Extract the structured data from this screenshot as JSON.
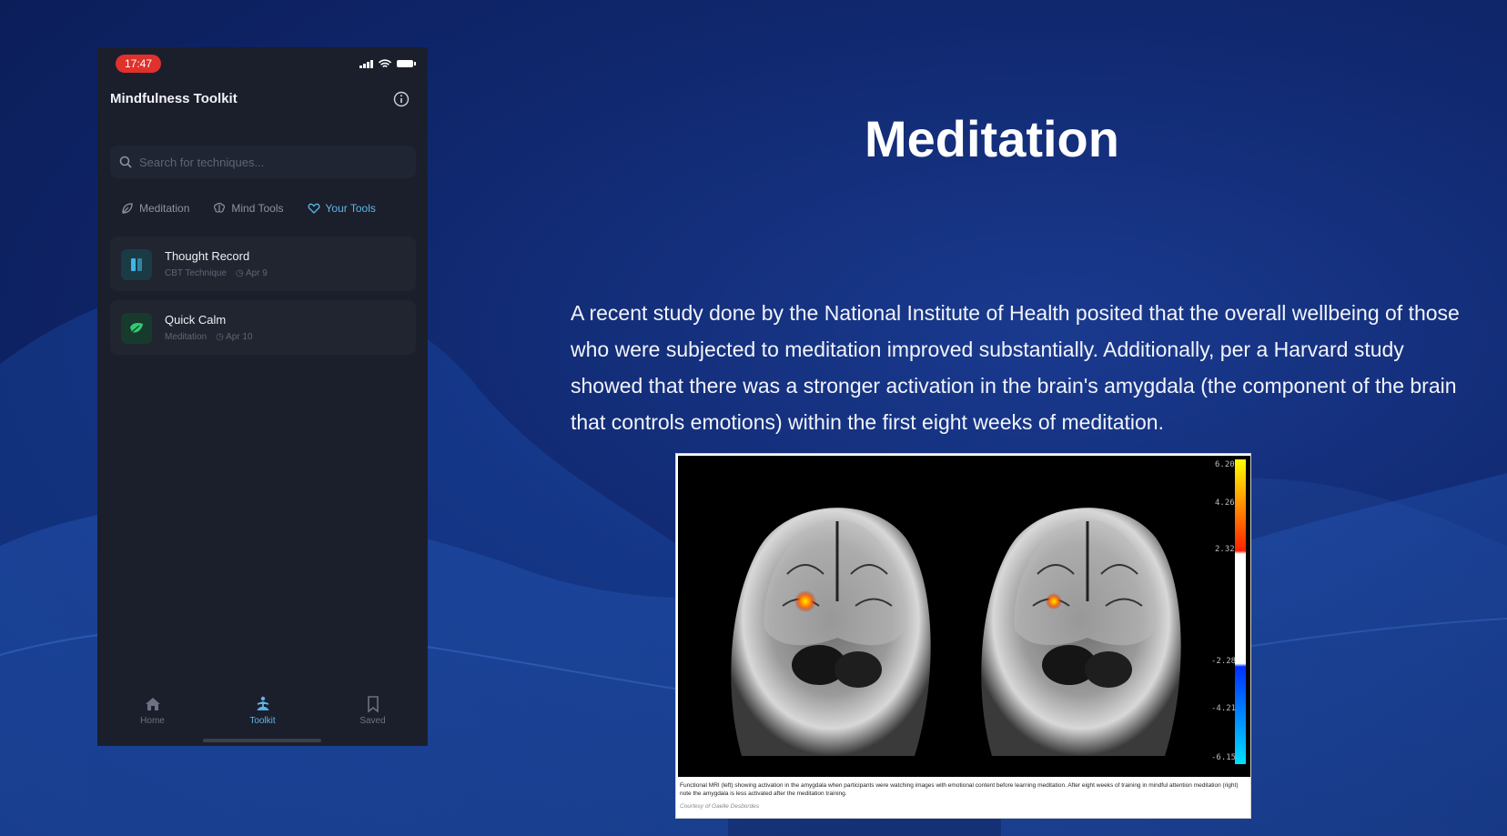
{
  "phone": {
    "status_time": "17:47",
    "app_title": "Mindfulness Toolkit",
    "search_placeholder": "Search for techniques...",
    "tabs": [
      {
        "label": "Meditation",
        "icon": "leaf-outline-icon",
        "active": false
      },
      {
        "label": "Mind Tools",
        "icon": "brain-icon",
        "active": false
      },
      {
        "label": "Your Tools",
        "icon": "heart-icon",
        "active": true
      }
    ],
    "cards": [
      {
        "title": "Thought Record",
        "category": "CBT Technique",
        "date": "Apr 9",
        "icon": "journal-icon",
        "icon_color": "#3fb6e6"
      },
      {
        "title": "Quick Calm",
        "category": "Meditation",
        "date": "Apr 10",
        "icon": "leaf-icon",
        "icon_color": "#2ecc71"
      }
    ],
    "nav": [
      {
        "label": "Home",
        "icon": "home-icon",
        "active": false
      },
      {
        "label": "Toolkit",
        "icon": "toolkit-icon",
        "active": true
      },
      {
        "label": "Saved",
        "icon": "bookmark-icon",
        "active": false
      }
    ],
    "accent_color": "#5fb5e8"
  },
  "slide": {
    "title": "Meditation",
    "body": "A recent study done by the National Institute of Health posited that the overall wellbeing of those who were subjected to meditation improved substantially. Additionally, per a Harvard study showed that there was a stronger activation in the brain's amygdala (the component of the brain that controls emotions) within the first eight weeks of meditation.",
    "figure": {
      "scale_values": [
        "6.20",
        "4.26",
        "2.32",
        "-2.28",
        "-4.21",
        "-6.15"
      ],
      "caption": "Functional MRI (left) showing activation in the amygdala when participants were watching images with emotional content before learning meditation. After eight weeks of training in mindful attention meditation (right) note the amygdala is less activated after the meditation training.",
      "credit": "Courtesy of Gaelle Desbordes"
    }
  }
}
